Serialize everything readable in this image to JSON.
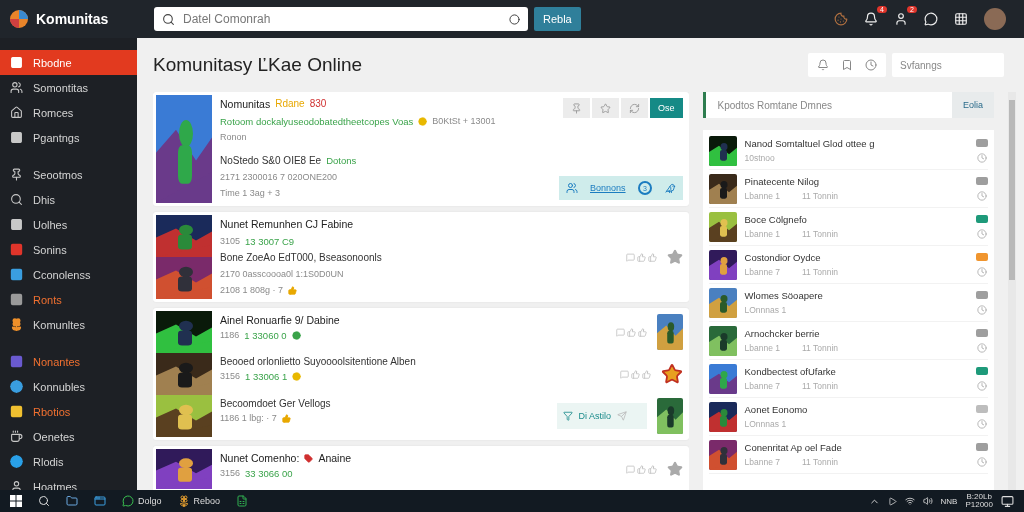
{
  "header": {
    "brand": "Komunitas",
    "search": {
      "placeholder": "Datel Comonrah"
    },
    "search_button": "Rebla",
    "icons": [
      {
        "kind": "cookie"
      },
      {
        "kind": "bell",
        "badge": "4"
      },
      {
        "kind": "user",
        "badge": "2"
      },
      {
        "kind": "chat"
      },
      {
        "kind": "grid"
      },
      {
        "kind": "avatar"
      }
    ]
  },
  "sidebar": {
    "groups": [
      [
        {
          "label": "Rbodne",
          "selected": true,
          "highlight": false
        },
        {
          "label": "Somontitas",
          "selected": false,
          "highlight": false
        },
        {
          "label": "Romces",
          "selected": false,
          "highlight": false
        },
        {
          "label": "Pgantngs",
          "selected": false,
          "highlight": false
        }
      ],
      [
        {
          "label": "Seootmos",
          "selected": false,
          "highlight": false
        },
        {
          "label": "Dhis",
          "selected": false,
          "highlight": false
        },
        {
          "label": "Uolhes",
          "selected": false,
          "highlight": false
        },
        {
          "label": "Sonins",
          "color": "#e0352b",
          "selected": false,
          "highlight": false
        },
        {
          "label": "Cconolenss",
          "color": "#3a9ee0",
          "selected": false,
          "highlight": false
        },
        {
          "label": "Ronts",
          "color": "#9a9a9a",
          "selected": false,
          "highlight": true
        },
        {
          "label": "Komunltes",
          "color": "#f0902a",
          "selected": false,
          "highlight": false
        }
      ],
      [
        {
          "label": "Nonantes",
          "color": "#6a5ad0",
          "selected": false,
          "highlight": true
        },
        {
          "label": "Konnubles",
          "color": "#3a9ee0",
          "selected": false,
          "highlight": false
        },
        {
          "label": "Rbotios",
          "color": "#f0c030",
          "selected": false,
          "highlight": true
        },
        {
          "label": "Oenetes",
          "selected": false,
          "highlight": false
        },
        {
          "label": "Rlodis",
          "color": "#2aa0e8",
          "selected": false,
          "highlight": false
        },
        {
          "label": "Hoatmes",
          "selected": false,
          "highlight": false
        }
      ]
    ]
  },
  "title": "Komunitasy ĽKae Online",
  "sort": {
    "value": "Svfanngs"
  },
  "cards": [
    {
      "kind": "featured",
      "entries": [
        {
          "pictures": [
            {
              "kind": "picture"
            }
          ],
          "lines": [
            [
              {
                "text": "Nomunitas",
                "kind": "title"
              },
              {
                "text": "Rdane",
                "kind": "warning"
              },
              {
                "text": "830",
                "kind": "alert"
              }
            ],
            [
              {
                "text": "Rotoom dockalyuseodobatedtheetcopes Voas",
                "kind": "positive"
              },
              {
                "kind": "coin"
              },
              {
                "text": "B0KtSt + 13001",
                "kind": "meta"
              }
            ],
            [
              {
                "text": "Ronon",
                "kind": "meta"
              }
            ],
            [
              {
                "text": "NoStedo S&0 OIE8 Ee",
                "kind": "body"
              },
              {
                "text": "Dotons",
                "kind": "positive"
              }
            ],
            [
              {
                "text": "2171 2300016 7 020ONE200",
                "kind": "meta"
              }
            ],
            [
              {
                "text": "Time 1 3ag + 3",
                "kind": "meta"
              }
            ]
          ],
          "side": [
            {
              "kind": "toolbar",
              "button": "Ose"
            },
            {
              "kind": "members",
              "label": "Bonnons",
              "count": "3"
            }
          ]
        }
      ]
    },
    {
      "kind": "group",
      "entries": [
        {
          "pictures": [
            {
              "kind": "picture"
            },
            {
              "kind": "picture"
            }
          ],
          "lines": [
            [
              {
                "text": "Nunet Remunhen CJ Fabine",
                "kind": "title"
              }
            ],
            [
              {
                "text": "3105",
                "kind": "meta"
              },
              {
                "text": "13 3007 C9",
                "kind": "positive"
              }
            ],
            [
              {
                "text": "Bone ZoeAo EdT000, Bseasonoonls",
                "kind": "body"
              }
            ],
            [
              {
                "text": "2170 0asscoooa0l 1:1S0D0UN",
                "kind": "meta"
              }
            ],
            [
              {
                "text": "2108 1 808g · 7",
                "kind": "meta"
              },
              {
                "kind": "thumb"
              }
            ]
          ],
          "side": [
            {
              "kind": "reactions"
            },
            {
              "kind": "star"
            }
          ]
        }
      ]
    },
    {
      "kind": "group",
      "entries": [
        {
          "pictures": [
            {
              "kind": "picture"
            }
          ],
          "lines": [
            [
              {
                "text": "Ainel Ronuarfie 9/ Dabine",
                "kind": "title"
              }
            ],
            [
              {
                "text": "1186",
                "kind": "meta"
              },
              {
                "text": "1 33060 0",
                "kind": "positive"
              },
              {
                "kind": "dot"
              }
            ]
          ],
          "side": [
            {
              "kind": "reactions"
            },
            {
              "kind": "picture"
            }
          ]
        },
        {
          "pictures": [
            {
              "kind": "picture"
            }
          ],
          "lines": [
            [
              {
                "text": "Beooed orlonlietto Suyoooolsitentione Alben",
                "kind": "body"
              }
            ],
            [
              {
                "text": "3156",
                "kind": "meta"
              },
              {
                "text": "1 33006 1",
                "kind": "positive"
              },
              {
                "kind": "coin"
              }
            ]
          ],
          "side": [
            {
              "kind": "reactions"
            },
            {
              "kind": "badge"
            }
          ]
        },
        {
          "pictures": [
            {
              "kind": "picture"
            }
          ],
          "lines": [
            [
              {
                "text": "Becoomdoet Ger Vellogs",
                "kind": "body"
              }
            ],
            [
              {
                "text": "1186 1 lbg: · 7",
                "kind": "meta"
              },
              {
                "kind": "thumb"
              }
            ]
          ],
          "side": [
            {
              "kind": "action",
              "label": "Di Astilo"
            },
            {
              "kind": "picture"
            }
          ]
        }
      ]
    },
    {
      "kind": "group",
      "entries": [
        {
          "pictures": [
            {
              "kind": "picture"
            }
          ],
          "lines": [
            [
              {
                "text": "Nunet Comenho:",
                "kind": "title"
              },
              {
                "kind": "tag"
              },
              {
                "text": "Anaine",
                "kind": "title"
              }
            ],
            [
              {
                "text": "3156",
                "kind": "meta"
              },
              {
                "text": "33 3066 00",
                "kind": "positive"
              }
            ]
          ],
          "side": [
            {
              "kind": "reactions"
            },
            {
              "kind": "star"
            }
          ]
        }
      ]
    }
  ],
  "side_panel": {
    "search": {
      "placeholder": "Kpodtos Romtane Dmnes"
    },
    "button": "Eolia",
    "items": [
      {
        "title": "Nanod Somtaltuel Glod ottee g",
        "meta": [
          "10stnoo"
        ],
        "color": "#9e9e9e"
      },
      {
        "title": "Pinatecente Nilog",
        "meta": [
          "Lbanne 1",
          "11 Tonnin"
        ],
        "color": "#9e9e9e"
      },
      {
        "title": "Boce Cölgnefo",
        "meta": [
          "Lbanne 1",
          "11 Tonnin"
        ],
        "color": "#1e9a7a"
      },
      {
        "title": "Costondior Oydce",
        "meta": [
          "Lbanne 7",
          "11 Tonnin"
        ],
        "color": "#f0952e"
      },
      {
        "title": "Wlomes Söoapere",
        "meta": [
          "LOnnnas 1"
        ],
        "color": "#9e9e9e"
      },
      {
        "title": "Arnochcker berrie",
        "meta": [
          "Lbanne 1",
          "11 Tonnin"
        ],
        "color": "#9e9e9e"
      },
      {
        "title": "Kondbectest ofUfarke",
        "meta": [
          "Lbanne 7",
          "11 Tonnin"
        ],
        "color": "#1e9a7a"
      },
      {
        "title": "Aonet Eonomo",
        "meta": [
          "LOnnnas 1"
        ],
        "color": "#bdbdbd"
      },
      {
        "title": "Conenritat Ap oel Fade",
        "meta": [
          "Lbanne 7",
          "11 Tonnin"
        ],
        "color": "#9e9e9e"
      }
    ]
  },
  "taskbar": {
    "apps": [
      {
        "kind": "folder"
      },
      {
        "kind": "app"
      },
      {
        "kind": "chat",
        "label": "Dolgo"
      },
      {
        "kind": "flower",
        "label": "Reboo"
      },
      {
        "kind": "sheet"
      }
    ],
    "tray": "NNB",
    "time": "B:20Lb",
    "date": "P12000"
  }
}
